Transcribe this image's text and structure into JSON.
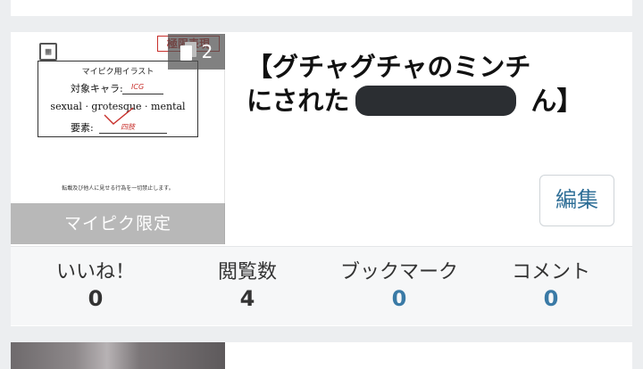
{
  "work": {
    "title_line1": "【グチャグチャのミンチ",
    "title_line2": "にされた　　　　　　　ん】",
    "page_count": "2",
    "visibility_badge": "マイピク限定",
    "edit_label": "編集"
  },
  "thumbnail": {
    "stamp_text": "極限表現",
    "sheet_title": "マイピク用イラスト",
    "character_label": "対象キャラ:",
    "character_handwritten": "ICG",
    "tags_line": "sexual · grotesque · mental",
    "element_label": "要素:",
    "element_handwritten": "四肢",
    "footer_note": "転載及び他人に見せる行為を一切禁止します。"
  },
  "stats": [
    {
      "label": "いいね！",
      "value": "0"
    },
    {
      "label": "閲覧数",
      "value": "4"
    },
    {
      "label": "ブックマーク",
      "value": "0"
    },
    {
      "label": "コメント",
      "value": "0"
    }
  ],
  "colors": {
    "accent_blue": "#3a7aa6",
    "edit_text": "#2f6f97",
    "background": "#eceef0",
    "redaction": "#2b2e32"
  }
}
